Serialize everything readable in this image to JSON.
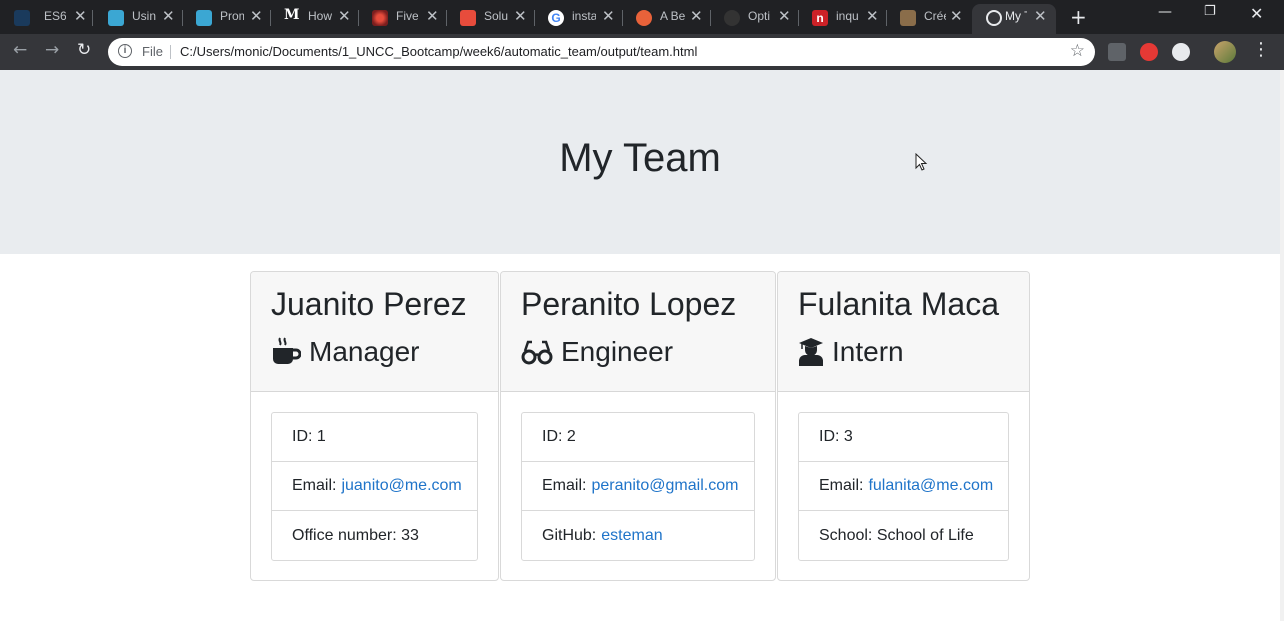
{
  "browser": {
    "tabs": [
      {
        "title": "ES6",
        "fav": "#3b6ea8"
      },
      {
        "title": "Using",
        "fav": "#3ba7d3"
      },
      {
        "title": "Promi",
        "fav": "#3ba7d3"
      },
      {
        "title": "How",
        "fav": "#ffffff"
      },
      {
        "title": "Five",
        "fav": "#c0392b"
      },
      {
        "title": "Solu",
        "fav": "#e74c3c"
      },
      {
        "title": "insta",
        "fav": "#4285f4"
      },
      {
        "title": "A Be",
        "fav": "#e8623a"
      },
      {
        "title": "Opti",
        "fav": "#333333"
      },
      {
        "title": "inqu",
        "fav": "#cc2127"
      },
      {
        "title": "Créer",
        "fav": "#8a6d4a"
      },
      {
        "title": "My T",
        "fav": "#e8eaed"
      }
    ],
    "address": {
      "file_label": "File",
      "url": "C:/Users/monic/Documents/1_UNCC_Bootcamp/week6/automatic_team/output/team.html"
    }
  },
  "page": {
    "title": "My Team"
  },
  "team": [
    {
      "name": "Juanito Perez",
      "role": "Manager",
      "icon": "coffee-icon",
      "id_label": "ID: 1",
      "email_label": "Email:",
      "email": "juanito@me.com",
      "extra_label": "Office number: 33",
      "extra_link": ""
    },
    {
      "name": "Peranito Lopez",
      "role": "Engineer",
      "icon": "glasses-icon",
      "id_label": "ID: 2",
      "email_label": "Email:",
      "email": "peranito@gmail.com",
      "extra_label": "GitHub:",
      "extra_link": "esteman"
    },
    {
      "name": "Fulanita Maca",
      "role": "Intern",
      "icon": "graduate-icon",
      "id_label": "ID: 3",
      "email_label": "Email:",
      "email": "fulanita@me.com",
      "extra_label": "School: School of Life",
      "extra_link": ""
    }
  ],
  "colors": {
    "link": "#1f74c9",
    "jumbotron": "#e9ecef",
    "card_header": "#f7f7f7"
  }
}
